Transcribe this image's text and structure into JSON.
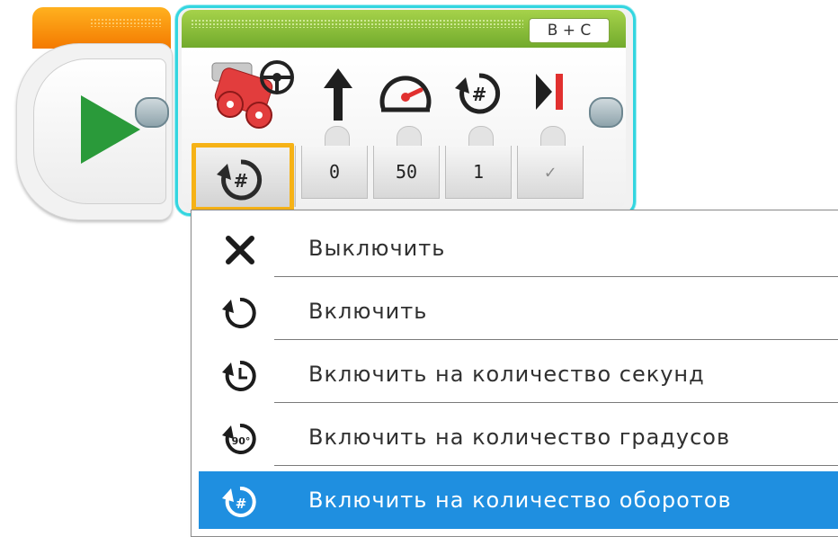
{
  "start_block": {
    "icon": "play-icon",
    "accent_color": "#f47a00",
    "play_color": "#2a9a3a"
  },
  "motor_block": {
    "port_label": "B + C",
    "accent_color": "#6fa82b",
    "selection_border_color": "#33d6e0",
    "header_icons": [
      "steering-motors-icon",
      "power-arrow-icon",
      "speedometer-icon",
      "rotations-icon",
      "brake-at-end-icon"
    ],
    "current_mode_icon": "rotations-icon",
    "params": [
      {
        "name": "steering",
        "value": "0"
      },
      {
        "name": "power",
        "value": "50"
      },
      {
        "name": "rotations",
        "value": "1"
      },
      {
        "name": "brake",
        "value": "✓"
      }
    ],
    "mode_highlight_color": "#f6b216"
  },
  "mode_menu": {
    "selected_index": 4,
    "selected_color": "#1f8fe0",
    "items": [
      {
        "icon": "close-x-icon",
        "label": "Выключить"
      },
      {
        "icon": "rotate-on-icon",
        "label": "Включить"
      },
      {
        "icon": "seconds-timer-icon",
        "label": "Включить на количество секунд"
      },
      {
        "icon": "degrees-90-icon",
        "label": "Включить на количество градусов"
      },
      {
        "icon": "rotations-icon",
        "label": "Включить на количество оборотов"
      }
    ]
  }
}
